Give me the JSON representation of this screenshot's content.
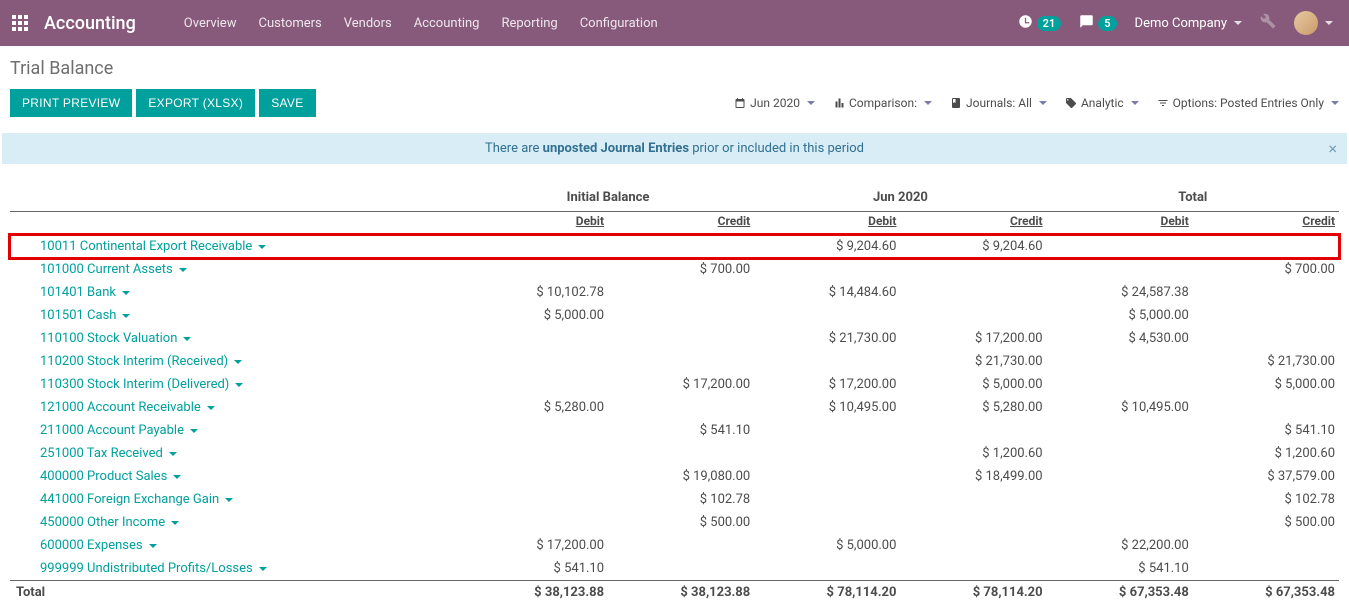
{
  "topbar": {
    "app_name": "Accounting",
    "nav": [
      "Overview",
      "Customers",
      "Vendors",
      "Accounting",
      "Reporting",
      "Configuration"
    ],
    "clock_count": "21",
    "msg_count": "5",
    "company": "Demo Company"
  },
  "page": {
    "title": "Trial Balance",
    "buttons": {
      "print": "PRINT PREVIEW",
      "export": "EXPORT (XLSX)",
      "save": "SAVE"
    },
    "filters": {
      "date": "Jun 2020",
      "comparison": "Comparison:",
      "journals": "Journals: All",
      "analytic": "Analytic",
      "options": "Options: Posted Entries Only"
    },
    "banner_pre": "There are ",
    "banner_bold": "unposted Journal Entries",
    "banner_post": " prior or included in this period"
  },
  "table": {
    "group_headers": [
      "",
      "Initial Balance",
      "Jun 2020",
      "Total"
    ],
    "sub_headers": [
      "",
      "Debit",
      "Credit",
      "Debit",
      "Credit",
      "Debit",
      "Credit"
    ],
    "rows": [
      {
        "name": "10011 Continental Export Receivable",
        "ib_d": "",
        "ib_c": "",
        "p_d": "$ 9,204.60",
        "p_c": "$ 9,204.60",
        "t_d": "",
        "t_c": "",
        "highlight": true
      },
      {
        "name": "101000 Current Assets",
        "ib_d": "",
        "ib_c": "$ 700.00",
        "p_d": "",
        "p_c": "",
        "t_d": "",
        "t_c": "$ 700.00"
      },
      {
        "name": "101401 Bank",
        "ib_d": "$ 10,102.78",
        "ib_c": "",
        "p_d": "$ 14,484.60",
        "p_c": "",
        "t_d": "$ 24,587.38",
        "t_c": ""
      },
      {
        "name": "101501 Cash",
        "ib_d": "$ 5,000.00",
        "ib_c": "",
        "p_d": "",
        "p_c": "",
        "t_d": "$ 5,000.00",
        "t_c": ""
      },
      {
        "name": "110100 Stock Valuation",
        "ib_d": "",
        "ib_c": "",
        "p_d": "$ 21,730.00",
        "p_c": "$ 17,200.00",
        "t_d": "$ 4,530.00",
        "t_c": ""
      },
      {
        "name": "110200 Stock Interim (Received)",
        "ib_d": "",
        "ib_c": "",
        "p_d": "",
        "p_c": "$ 21,730.00",
        "t_d": "",
        "t_c": "$ 21,730.00"
      },
      {
        "name": "110300 Stock Interim (Delivered)",
        "ib_d": "",
        "ib_c": "$ 17,200.00",
        "p_d": "$ 17,200.00",
        "p_c": "$ 5,000.00",
        "t_d": "",
        "t_c": "$ 5,000.00"
      },
      {
        "name": "121000 Account Receivable",
        "ib_d": "$ 5,280.00",
        "ib_c": "",
        "p_d": "$ 10,495.00",
        "p_c": "$ 5,280.00",
        "t_d": "$ 10,495.00",
        "t_c": ""
      },
      {
        "name": "211000 Account Payable",
        "ib_d": "",
        "ib_c": "$ 541.10",
        "p_d": "",
        "p_c": "",
        "t_d": "",
        "t_c": "$ 541.10"
      },
      {
        "name": "251000 Tax Received",
        "ib_d": "",
        "ib_c": "",
        "p_d": "",
        "p_c": "$ 1,200.60",
        "t_d": "",
        "t_c": "$ 1,200.60"
      },
      {
        "name": "400000 Product Sales",
        "ib_d": "",
        "ib_c": "$ 19,080.00",
        "p_d": "",
        "p_c": "$ 18,499.00",
        "t_d": "",
        "t_c": "$ 37,579.00"
      },
      {
        "name": "441000 Foreign Exchange Gain",
        "ib_d": "",
        "ib_c": "$ 102.78",
        "p_d": "",
        "p_c": "",
        "t_d": "",
        "t_c": "$ 102.78"
      },
      {
        "name": "450000 Other Income",
        "ib_d": "",
        "ib_c": "$ 500.00",
        "p_d": "",
        "p_c": "",
        "t_d": "",
        "t_c": "$ 500.00"
      },
      {
        "name": "600000 Expenses",
        "ib_d": "$ 17,200.00",
        "ib_c": "",
        "p_d": "$ 5,000.00",
        "p_c": "",
        "t_d": "$ 22,200.00",
        "t_c": ""
      },
      {
        "name": "999999 Undistributed Profits/Losses",
        "ib_d": "$ 541.10",
        "ib_c": "",
        "p_d": "",
        "p_c": "",
        "t_d": "$ 541.10",
        "t_c": ""
      }
    ],
    "total": {
      "label": "Total",
      "ib_d": "$ 38,123.88",
      "ib_c": "$ 38,123.88",
      "p_d": "$ 78,114.20",
      "p_c": "$ 78,114.20",
      "t_d": "$ 67,353.48",
      "t_c": "$ 67,353.48"
    }
  }
}
